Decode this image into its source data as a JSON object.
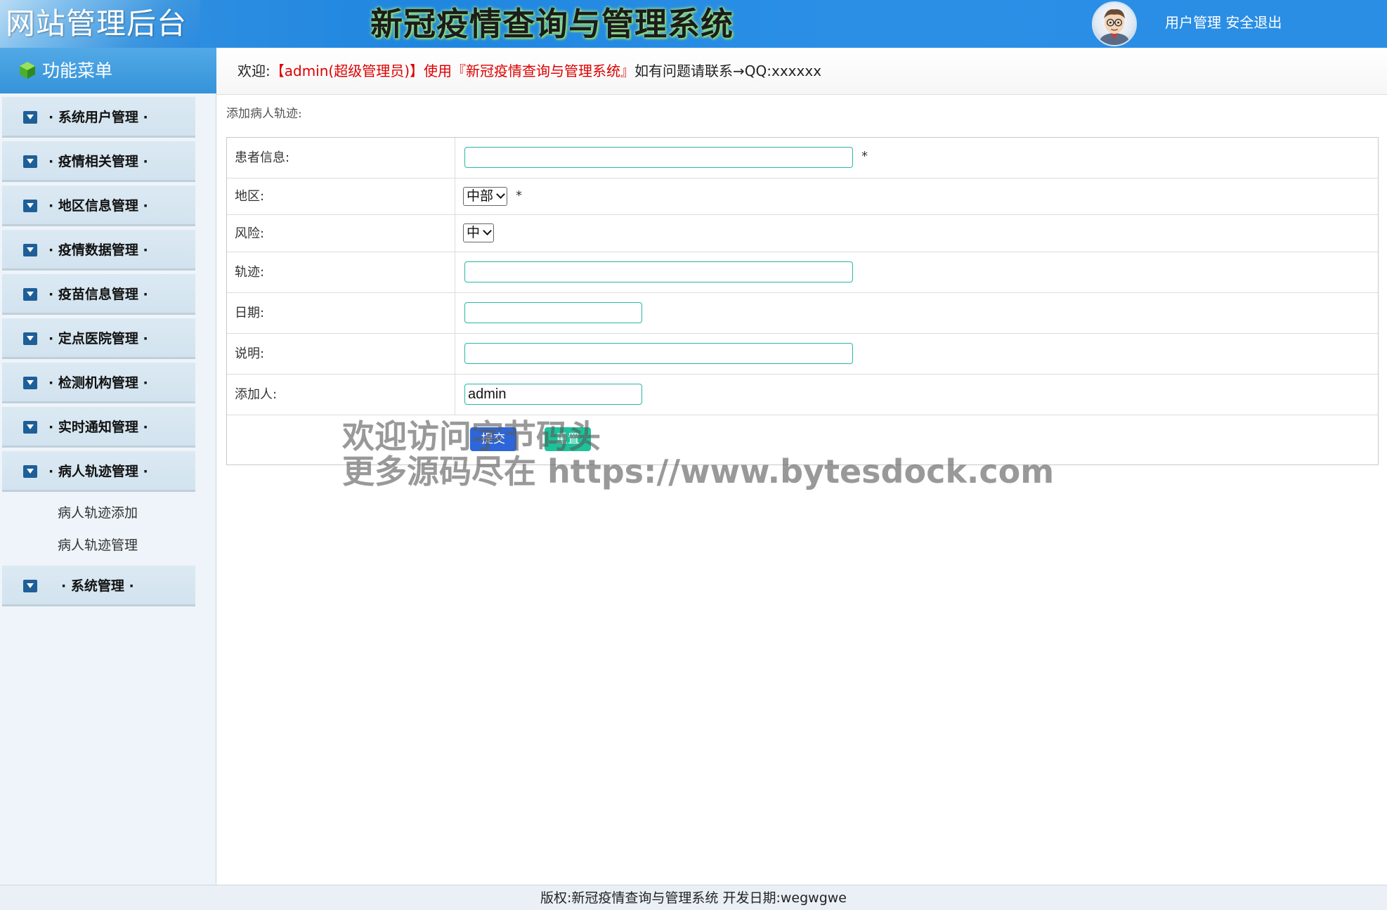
{
  "header": {
    "site_name": "网站管理后台",
    "system_title": "新冠疫情查询与管理系统",
    "links": {
      "user_manage": "用户管理",
      "logout": "安全退出"
    }
  },
  "sidebar": {
    "title": "功能菜单",
    "groups": [
      "· 系统用户管理 ·",
      "· 疫情相关管理 ·",
      "· 地区信息管理 ·",
      "· 疫情数据管理 ·",
      "· 疫苗信息管理 ·",
      "· 定点医院管理 ·",
      "· 检测机构管理 ·",
      "· 实时通知管理 ·",
      "· 病人轨迹管理 ·",
      "· 系统管理 ·"
    ],
    "submenu": [
      "病人轨迹添加",
      "病人轨迹管理"
    ]
  },
  "welcome": {
    "prefix": "欢迎:",
    "highlight": "【admin(超级管理员)】使用『新冠疫情查询与管理系统』",
    "suffix": "如有问题请联系→QQ:xxxxxx"
  },
  "form": {
    "heading": "添加病人轨迹:",
    "labels": {
      "patient": "患者信息:",
      "region": "地区:",
      "risk": "风险:",
      "track": "轨迹:",
      "date": "日期:",
      "note": "说明:",
      "adder": "添加人:"
    },
    "values": {
      "patient": "",
      "region": "中部",
      "risk": "中",
      "track": "",
      "date": "",
      "note": "",
      "adder": "admin"
    },
    "required_mark": "*",
    "submit": "提交",
    "reset": "重置"
  },
  "watermark": {
    "line1": "欢迎访问字节码头",
    "line2": "更多源码尽在  https://www.bytesdock.com"
  },
  "footer": {
    "text": "版权:新冠疫情查询与管理系统 开发日期:wegwgwe"
  }
}
